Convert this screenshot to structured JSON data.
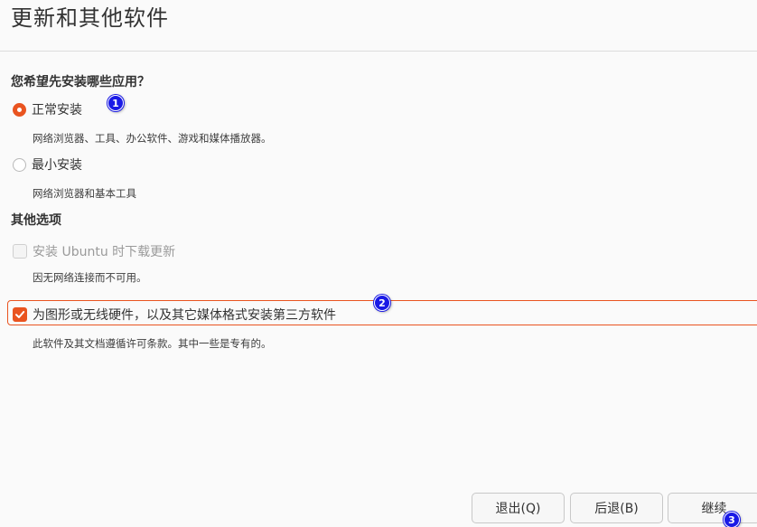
{
  "page": {
    "title": "更新和其他软件"
  },
  "install_type": {
    "heading": "您希望先安装哪些应用？",
    "options": [
      {
        "label": "正常安装",
        "description": "网络浏览器、工具、办公软件、游戏和媒体播放器。",
        "selected": true
      },
      {
        "label": "最小安装",
        "description": "网络浏览器和基本工具",
        "selected": false
      }
    ]
  },
  "other_options": {
    "heading": "其他选项",
    "download_updates": {
      "label": "安装 Ubuntu 时下载更新",
      "description": "因无网络连接而不可用。",
      "checked": false,
      "enabled": false
    },
    "third_party": {
      "label": "为图形或无线硬件，以及其它媒体格式安装第三方软件",
      "description": "此软件及其文档遵循许可条款。其中一些是专有的。",
      "checked": true,
      "enabled": true
    }
  },
  "buttons": {
    "quit": "退出(Q)",
    "back": "后退(B)",
    "continue": "继续"
  },
  "annotations": {
    "badge_1": "1",
    "badge_2": "2",
    "badge_3": "3"
  },
  "colors": {
    "accent": "#e95420",
    "badge": "#1a1ae6"
  }
}
